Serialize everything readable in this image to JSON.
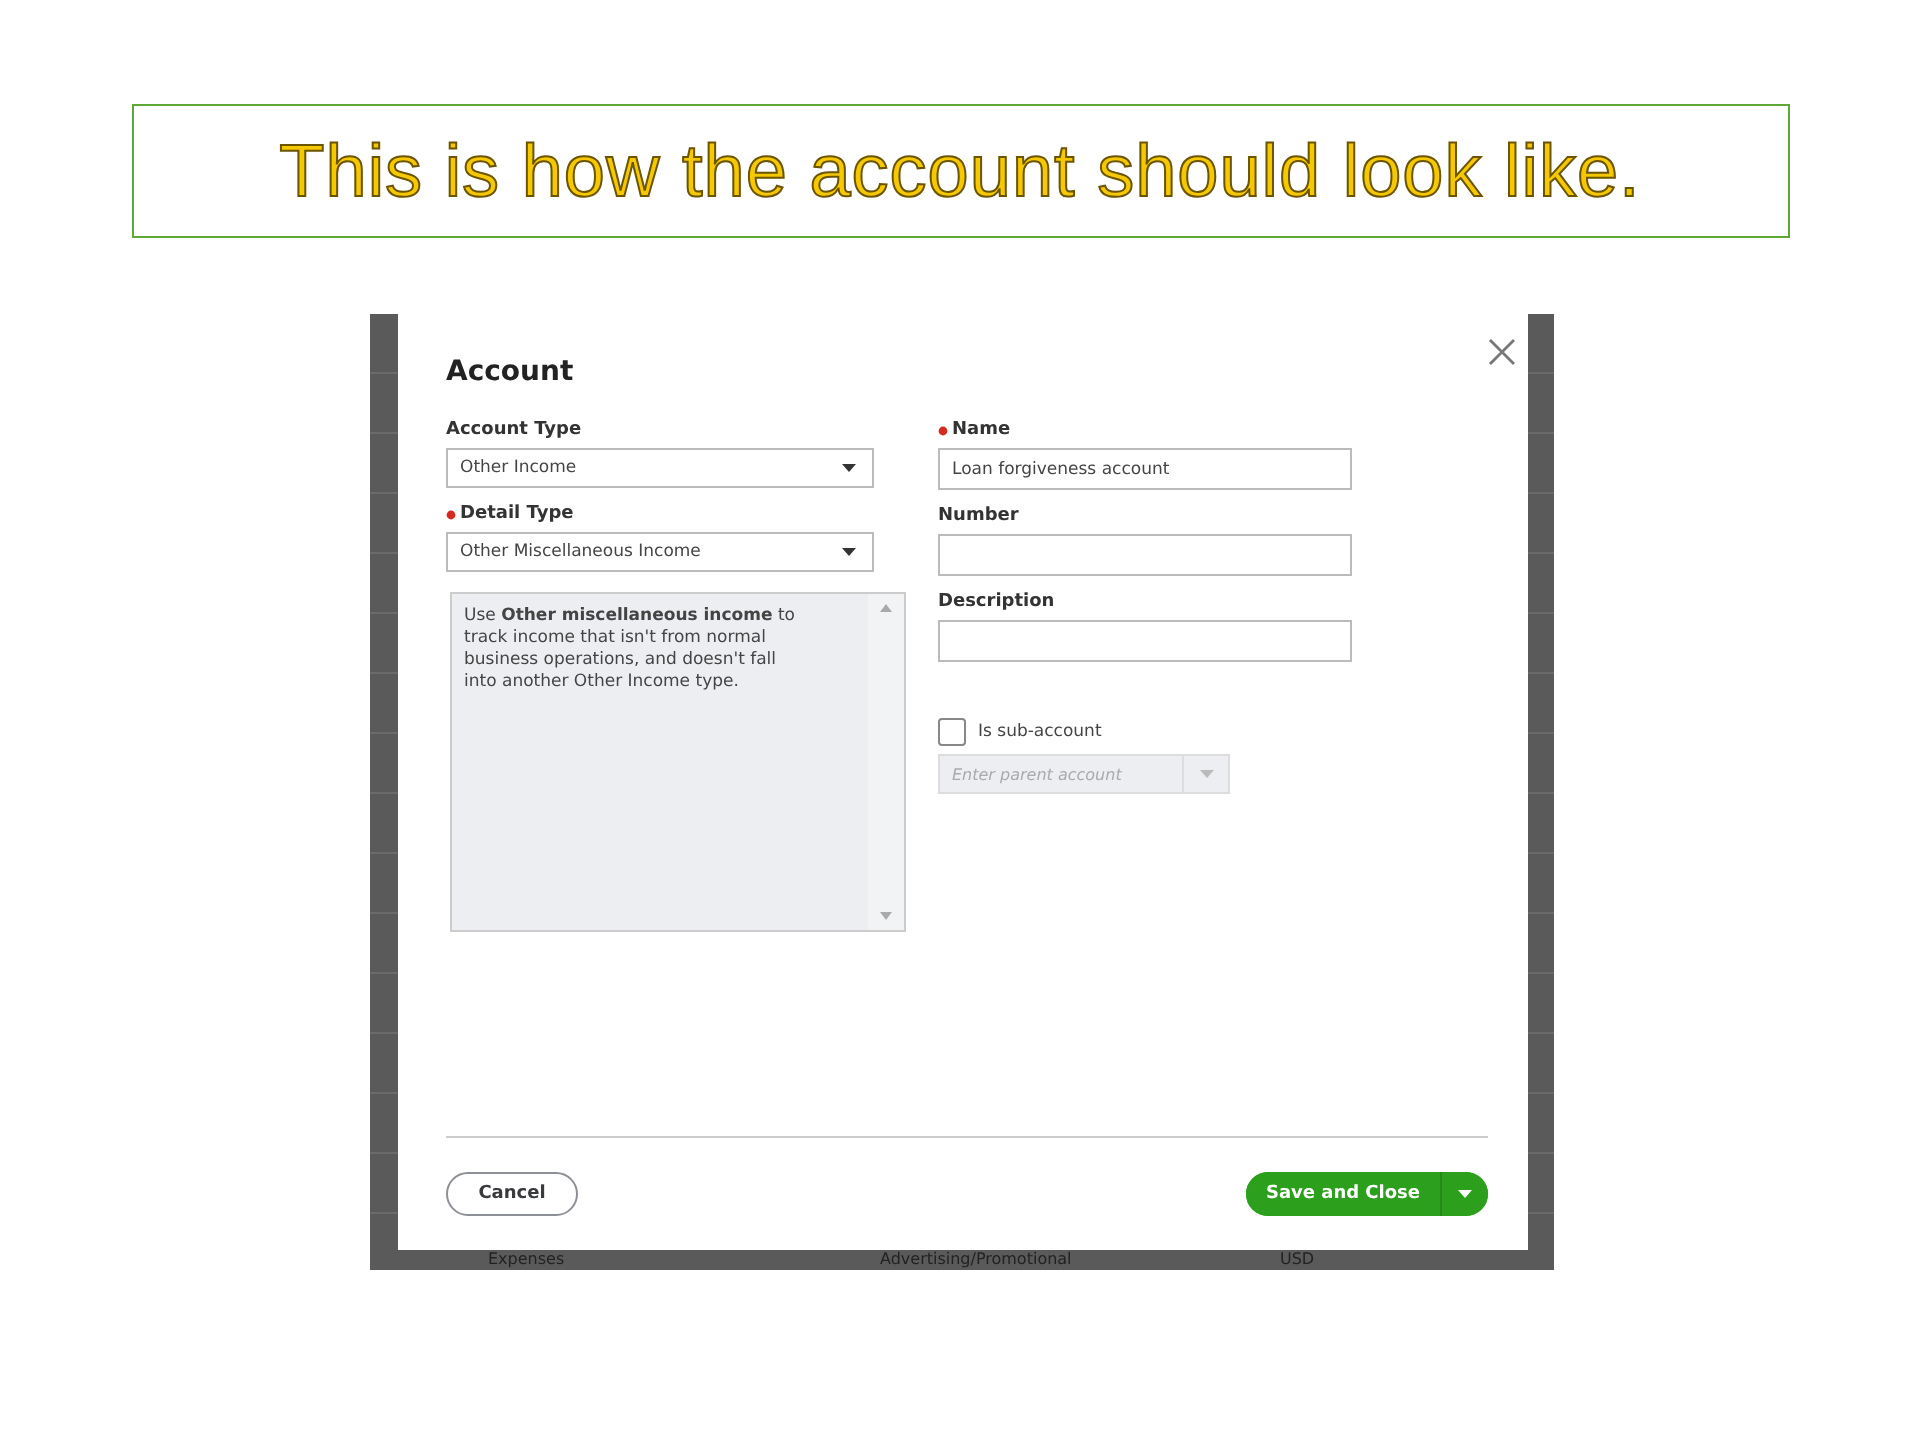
{
  "slide_title": "This is how the account should look like.",
  "dialog": {
    "title": "Account",
    "left_fields": [
      {
        "label": "Account Type",
        "required": false,
        "value": "Other Income"
      },
      {
        "label": "Detail Type",
        "required": true,
        "value": "Other Miscellaneous Income"
      }
    ],
    "detail_description": "Use **Other miscellaneous income** to track income that isn't from normal business operations, and doesn't fall into another Other Income type.",
    "right_fields": [
      {
        "label": "Name",
        "required": true,
        "value": "Loan forgiveness account"
      },
      {
        "label": "Number",
        "required": false
      },
      {
        "label": "Description",
        "required": false
      }
    ],
    "sub_account": {
      "label": "Is sub-account",
      "checked": false
    },
    "parent_account": {
      "placeholder": "Enter parent account",
      "disabled": true
    },
    "buttons": {
      "cancel": "Cancel",
      "save": "Save and Close"
    }
  },
  "background_row": [
    "Expenses",
    "Advertising/Promotional",
    "USD"
  ]
}
